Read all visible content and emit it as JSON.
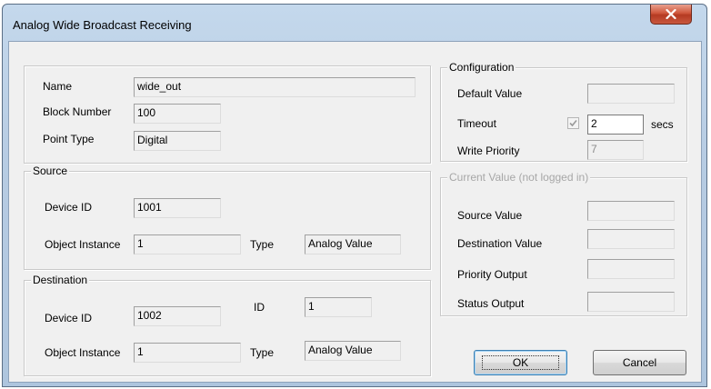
{
  "window": {
    "title": "Analog Wide Broadcast Receiving"
  },
  "info": {
    "name_label": "Name",
    "name_value": "wide_out",
    "block_label": "Block Number",
    "block_value": "100",
    "point_label": "Point Type",
    "point_value": "Digital"
  },
  "source": {
    "legend": "Source",
    "device_label": "Device ID",
    "device_value": "1001",
    "instance_label": "Object Instance",
    "instance_value": "1",
    "type_label": "Type",
    "type_value": "Analog Value"
  },
  "destination": {
    "legend": "Destination",
    "device_label": "Device ID",
    "device_value": "1002",
    "id_label": "ID",
    "id_value": "1",
    "instance_label": "Object Instance",
    "instance_value": "1",
    "type_label": "Type",
    "type_value": "Analog Value"
  },
  "configuration": {
    "legend": "Configuration",
    "default_label": "Default Value",
    "default_value": "",
    "timeout_label": "Timeout",
    "timeout_value": "2",
    "timeout_checked": true,
    "timeout_unit": "secs",
    "priority_label": "Write Priority",
    "priority_value": "7"
  },
  "current": {
    "legend": "Current Value (not logged in)",
    "source_label": "Source Value",
    "source_value": "",
    "dest_label": "Destination Value",
    "dest_value": "",
    "priority_label": "Priority Output",
    "priority_value": "",
    "status_label": "Status Output",
    "status_value": ""
  },
  "buttons": {
    "ok": "OK",
    "cancel": "Cancel"
  }
}
